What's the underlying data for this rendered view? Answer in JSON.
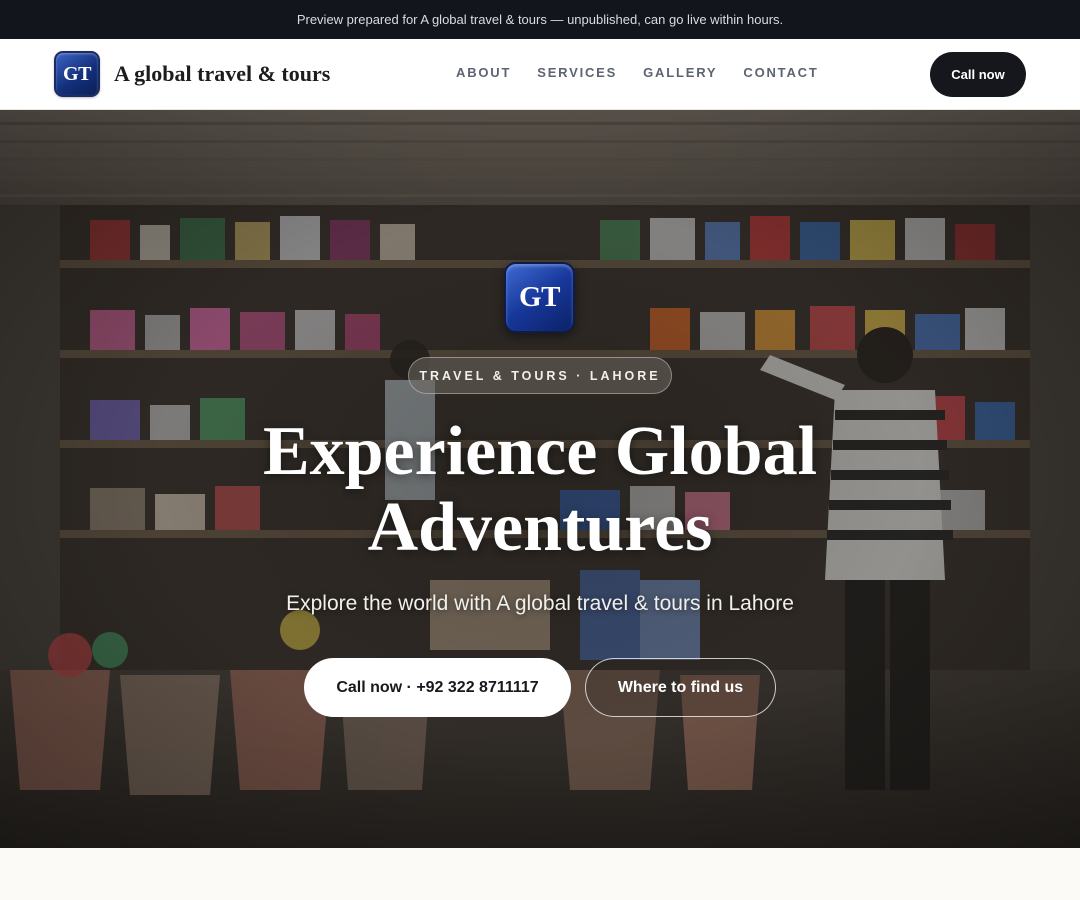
{
  "preview_banner": {
    "text": "Preview prepared for A global travel & tours — unpublished, can go live within hours."
  },
  "header": {
    "logo_text": "GT",
    "brand_name": "A global travel & tours",
    "nav": [
      {
        "label": "ABOUT"
      },
      {
        "label": "SERVICES"
      },
      {
        "label": "GALLERY"
      },
      {
        "label": "CONTACT"
      }
    ],
    "cta_label": "Call now"
  },
  "hero": {
    "logo_text": "GT",
    "tagline": "TRAVEL & TOURS · LAHORE",
    "title": "Experience Global Adventures",
    "subtitle": "Explore the world with A global travel & tours in Lahore",
    "primary_button": "Call now · +92 322 8711117",
    "secondary_button": "Where to find us",
    "background_image": "shop-storefront-photo"
  },
  "colors": {
    "banner_bg": "#13151c",
    "header_bg": "#ffffff",
    "logo_blue": "#17379a",
    "dark_button": "#15171c",
    "page_bg": "#fbfaf7"
  }
}
